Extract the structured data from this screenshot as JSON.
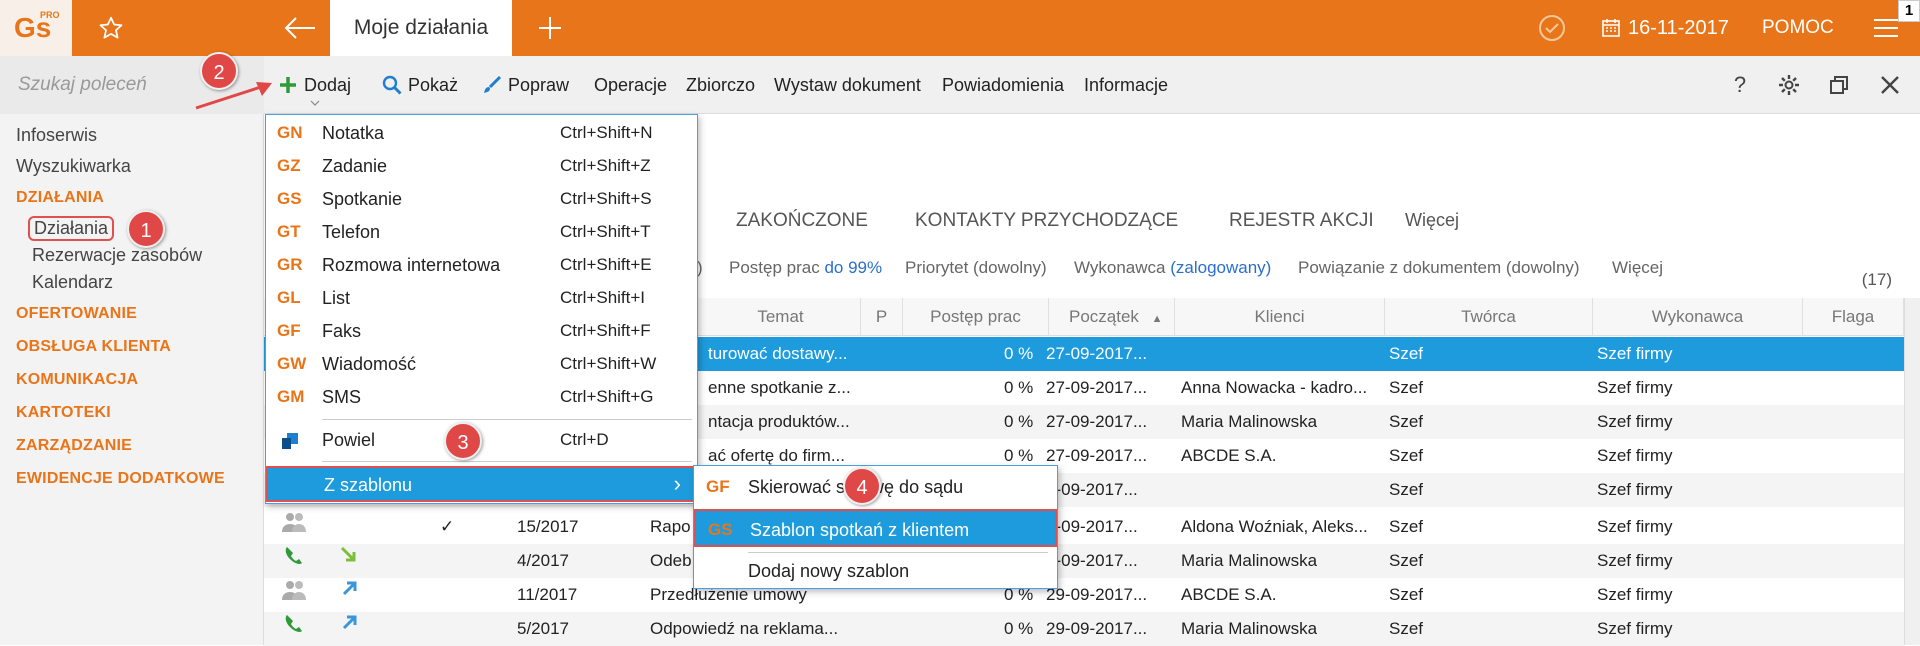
{
  "topbar": {
    "logo": "Gs",
    "logo_sup": "PRO",
    "active_tab": "Moje działania",
    "date": "16-11-2017",
    "help": "POMOC",
    "corner_badge": "1"
  },
  "search": {
    "placeholder": "Szukaj poleceń"
  },
  "sidebar": {
    "top_items": [
      "Infoserwis",
      "Wyszukiwarka"
    ],
    "section_dzialania": "DZIAŁANIA",
    "sub_items": [
      "Działania",
      "Rezerwacje zasobów",
      "Kalendarz"
    ],
    "sections": [
      "OFERTOWANIE",
      "OBSŁUGA KLIENTA",
      "KOMUNIKACJA",
      "KARTOTEKI",
      "ZARZĄDZANIE",
      "EWIDENCJE DODATKOWE"
    ]
  },
  "toolbar": {
    "add": "Dodaj",
    "show": "Pokaż",
    "edit": "Popraw",
    "operations": "Operacje",
    "bulk": "Zbiorczo",
    "issue_doc": "Wystaw dokument",
    "notifications": "Powiadomienia",
    "info": "Informacje"
  },
  "tabs": [
    "ZAKOŃCZONE",
    "KONTAKTY PRZYCHODZĄCE",
    "REJESTR AKCJI",
    "Więcej"
  ],
  "filters": {
    "paren": ")",
    "progress_label": "Postęp prac",
    "progress_value": "do 99%",
    "priority": "Priorytet (dowolny)",
    "executor_label": "Wykonawca",
    "executor_value": "(zalogowany)",
    "link": "Powiązanie z dokumentem (dowolny)",
    "more": "Więcej",
    "count": "(17)"
  },
  "columns": [
    "Temat",
    "P",
    "Postęp prac",
    "Początek",
    "Klienci",
    "Twórca",
    "Wykonawca",
    "Flaga"
  ],
  "rows": [
    {
      "temat": "turować dostawy...",
      "postep": "0 %",
      "poczatek": "27-09-2017...",
      "klienci": "",
      "tworca": "Szef",
      "wykonawca": "Szef firmy"
    },
    {
      "temat": "enne spotkanie z...",
      "postep": "0 %",
      "poczatek": "27-09-2017...",
      "klienci": "Anna Nowacka - kadro...",
      "tworca": "Szef",
      "wykonawca": "Szef firmy"
    },
    {
      "temat": "ntacja produktów...",
      "postep": "0 %",
      "poczatek": "27-09-2017...",
      "klienci": "Maria Malinowska",
      "tworca": "Szef",
      "wykonawca": "Szef firmy"
    },
    {
      "temat": "ać ofertę do firm...",
      "postep": "0 %",
      "poczatek": "27-09-2017...",
      "klienci": "ABCDE S.A.",
      "tworca": "Szef",
      "wykonawca": "Szef firmy"
    },
    {
      "temat": "",
      "postep": "",
      "poczatek": "7-09-2017...",
      "klienci": "",
      "tworca": "Szef",
      "wykonawca": "Szef firmy"
    },
    {
      "numer": "15/2017",
      "temat": "Rapo",
      "check": "✓",
      "postep": "",
      "poczatek": "7-09-2017...",
      "klienci": "Aldona Woźniak, Aleks...",
      "tworca": "Szef",
      "wykonawca": "Szef firmy"
    },
    {
      "numer": "4/2017",
      "temat": "Odeb",
      "postep": "",
      "poczatek": "8-09-2017...",
      "klienci": "Maria Malinowska",
      "tworca": "Szef",
      "wykonawca": "Szef firmy"
    },
    {
      "numer": "11/2017",
      "temat": "Przedłużenie umowy",
      "postep": "0 %",
      "poczatek": "29-09-2017...",
      "klienci": "ABCDE S.A.",
      "tworca": "Szef",
      "wykonawca": "Szef firmy"
    },
    {
      "numer": "5/2017",
      "temat": "Odpowiedź na reklama...",
      "postep": "0 %",
      "poczatek": "29-09-2017...",
      "klienci": "Maria Malinowska",
      "tworca": "Szef",
      "wykonawca": "Szef firmy"
    }
  ],
  "menu": {
    "items": [
      {
        "code": "GN",
        "label": "Notatka",
        "shortcut": "Ctrl+Shift+N"
      },
      {
        "code": "GZ",
        "label": "Zadanie",
        "shortcut": "Ctrl+Shift+Z"
      },
      {
        "code": "GS",
        "label": "Spotkanie",
        "shortcut": "Ctrl+Shift+S"
      },
      {
        "code": "GT",
        "label": "Telefon",
        "shortcut": "Ctrl+Shift+T"
      },
      {
        "code": "GR",
        "label": "Rozmowa internetowa",
        "shortcut": "Ctrl+Shift+E"
      },
      {
        "code": "GL",
        "label": "List",
        "shortcut": "Ctrl+Shift+I"
      },
      {
        "code": "GF",
        "label": "Faks",
        "shortcut": "Ctrl+Shift+F"
      },
      {
        "code": "GW",
        "label": "Wiadomość",
        "shortcut": "Ctrl+Shift+W"
      },
      {
        "code": "GM",
        "label": "SMS",
        "shortcut": "Ctrl+Shift+G"
      }
    ],
    "duplicate": {
      "label": "Powiel",
      "shortcut": "Ctrl+D"
    },
    "from_template": {
      "label": "Z szablonu",
      "arrow": "›"
    }
  },
  "submenu": {
    "items": [
      {
        "code": "GF",
        "label": "Skierować sprawę do sądu"
      },
      {
        "code": "GS",
        "label": "Szablon spotkań z klientem"
      }
    ],
    "add_new": "Dodaj nowy szablon"
  },
  "badges": [
    "1",
    "2",
    "3",
    "4"
  ],
  "colors": {
    "accent": "#e8751a",
    "selection": "#1e9bdc",
    "annotation": "#e04848"
  }
}
